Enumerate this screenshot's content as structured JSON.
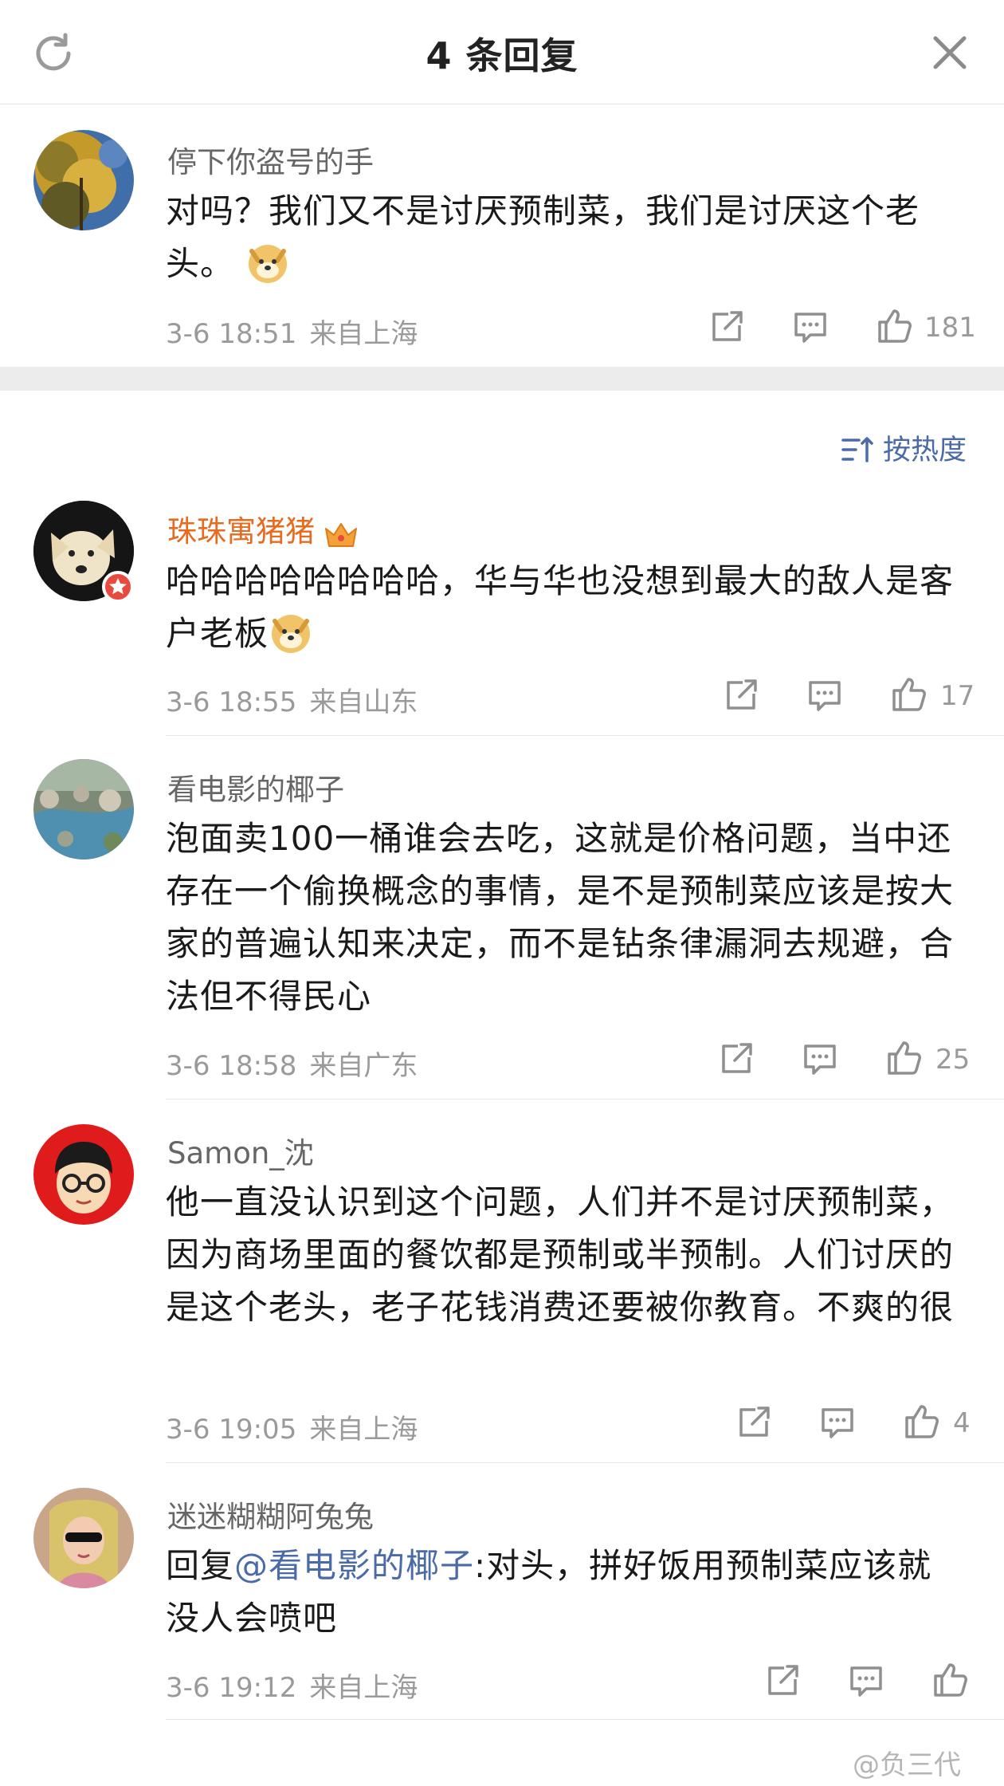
{
  "header": {
    "title": "4 条回复"
  },
  "sort": {
    "label": "按热度"
  },
  "main_comment": {
    "name": "停下你盗号的手",
    "text": "对吗？我们又不是讨厌预制菜，我们是讨厌这个老头。",
    "time": "3-6 18:51",
    "location": "来自上海",
    "likes": "181"
  },
  "replies": [
    {
      "name": "珠珠寓猪猪",
      "text": "哈哈哈哈哈哈哈哈，华与华也没想到最大的敌人是客户老板",
      "time": "3-6 18:55",
      "location": "来自山东",
      "likes": "17"
    },
    {
      "name": "看电影的椰子",
      "text": "泡面卖100一桶谁会去吃，这就是价格问题，当中还存在一个偷换概念的事情，是不是预制菜应该是按大家的普遍认知来决定，而不是钻条律漏洞去规避，合法但不得民心",
      "time": "3-6 18:58",
      "location": "来自广东",
      "likes": "25"
    },
    {
      "name": "Samon_沈",
      "text": "他一直没认识到这个问题，人们并不是讨厌预制菜，因为商场里面的餐饮都是预制或半预制。人们讨厌的是这个老头，老子花钱消费还要被你教育。不爽的很",
      "time": "3-6 19:05",
      "location": "来自上海",
      "likes": "4"
    },
    {
      "name": "迷迷糊糊阿兔兔",
      "reply_prefix": "回复",
      "mention": "@看电影的椰子",
      "text": ":对头，拼好饭用预制菜应该就没人会喷吧",
      "time": "3-6 19:12",
      "location": "来自上海",
      "likes": ""
    }
  ],
  "watermark": "@负三代",
  "icons": {
    "refresh": "refresh-icon",
    "close": "close-icon",
    "share": "share-icon",
    "comment": "comment-icon",
    "like": "thumbs-up-icon",
    "sort": "sort-icon",
    "emoji": "doge-emoji-icon",
    "crown": "crown-icon"
  },
  "colors": {
    "mention": "#4b6aa8",
    "vip_name": "#e86a1e",
    "meta": "#9a9a9a"
  }
}
